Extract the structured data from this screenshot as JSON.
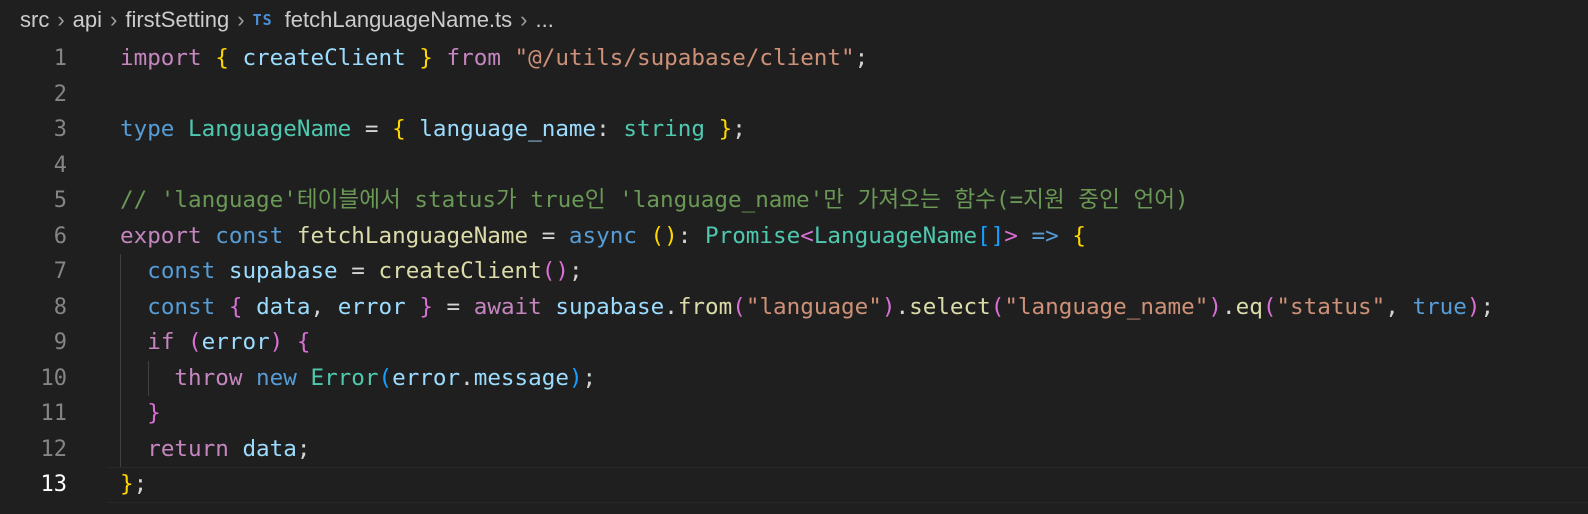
{
  "breadcrumb": {
    "items": [
      "src",
      "api",
      "firstSetting"
    ],
    "file_icon": "TS",
    "file_name": "fetchLanguageName.ts",
    "trailing": "..."
  },
  "editor": {
    "active_line": 13,
    "lines": [
      {
        "number": "1",
        "tokens": [
          {
            "t": "import",
            "c": "ctl"
          },
          {
            "t": " ",
            "c": "pn"
          },
          {
            "t": "{",
            "c": "b1"
          },
          {
            "t": " ",
            "c": "pn"
          },
          {
            "t": "createClient",
            "c": "var"
          },
          {
            "t": " ",
            "c": "pn"
          },
          {
            "t": "}",
            "c": "b1"
          },
          {
            "t": " ",
            "c": "pn"
          },
          {
            "t": "from",
            "c": "ctl"
          },
          {
            "t": " ",
            "c": "pn"
          },
          {
            "t": "\"@/utils/supabase/client\"",
            "c": "str"
          },
          {
            "t": ";",
            "c": "pn"
          }
        ]
      },
      {
        "number": "2",
        "tokens": []
      },
      {
        "number": "3",
        "tokens": [
          {
            "t": "type",
            "c": "kw"
          },
          {
            "t": " ",
            "c": "pn"
          },
          {
            "t": "LanguageName",
            "c": "typ"
          },
          {
            "t": " = ",
            "c": "pn"
          },
          {
            "t": "{",
            "c": "b1"
          },
          {
            "t": " ",
            "c": "pn"
          },
          {
            "t": "language_name",
            "c": "var"
          },
          {
            "t": ": ",
            "c": "pn"
          },
          {
            "t": "string",
            "c": "typ"
          },
          {
            "t": " ",
            "c": "pn"
          },
          {
            "t": "}",
            "c": "b1"
          },
          {
            "t": ";",
            "c": "pn"
          }
        ]
      },
      {
        "number": "4",
        "tokens": []
      },
      {
        "number": "5",
        "tokens": [
          {
            "t": "// 'language'테이블에서 status가 true인 'language_name'만 가져오는 함수(=지원 중인 언어)",
            "c": "com"
          }
        ]
      },
      {
        "number": "6",
        "tokens": [
          {
            "t": "export",
            "c": "ctl"
          },
          {
            "t": " ",
            "c": "pn"
          },
          {
            "t": "const",
            "c": "kw"
          },
          {
            "t": " ",
            "c": "pn"
          },
          {
            "t": "fetchLanguageName",
            "c": "fn"
          },
          {
            "t": " = ",
            "c": "pn"
          },
          {
            "t": "async",
            "c": "kw"
          },
          {
            "t": " ",
            "c": "pn"
          },
          {
            "t": "()",
            "c": "b1"
          },
          {
            "t": ": ",
            "c": "pn"
          },
          {
            "t": "Promise",
            "c": "typ"
          },
          {
            "t": "<",
            "c": "b2"
          },
          {
            "t": "LanguageName",
            "c": "typ"
          },
          {
            "t": "[]",
            "c": "b3"
          },
          {
            "t": ">",
            "c": "b2"
          },
          {
            "t": " ",
            "c": "pn"
          },
          {
            "t": "=>",
            "c": "kw"
          },
          {
            "t": " ",
            "c": "pn"
          },
          {
            "t": "{",
            "c": "b1"
          }
        ]
      },
      {
        "number": "7",
        "tokens": [
          {
            "t": "  ",
            "c": "pn"
          },
          {
            "t": "const",
            "c": "kw"
          },
          {
            "t": " ",
            "c": "pn"
          },
          {
            "t": "supabase",
            "c": "var"
          },
          {
            "t": " = ",
            "c": "pn"
          },
          {
            "t": "createClient",
            "c": "fn"
          },
          {
            "t": "()",
            "c": "b2"
          },
          {
            "t": ";",
            "c": "pn"
          }
        ]
      },
      {
        "number": "8",
        "tokens": [
          {
            "t": "  ",
            "c": "pn"
          },
          {
            "t": "const",
            "c": "kw"
          },
          {
            "t": " ",
            "c": "pn"
          },
          {
            "t": "{",
            "c": "b2"
          },
          {
            "t": " ",
            "c": "pn"
          },
          {
            "t": "data",
            "c": "var"
          },
          {
            "t": ", ",
            "c": "pn"
          },
          {
            "t": "error",
            "c": "var"
          },
          {
            "t": " ",
            "c": "pn"
          },
          {
            "t": "}",
            "c": "b2"
          },
          {
            "t": " = ",
            "c": "pn"
          },
          {
            "t": "await",
            "c": "ctl"
          },
          {
            "t": " ",
            "c": "pn"
          },
          {
            "t": "supabase",
            "c": "var"
          },
          {
            "t": ".",
            "c": "pn"
          },
          {
            "t": "from",
            "c": "fn"
          },
          {
            "t": "(",
            "c": "b2"
          },
          {
            "t": "\"language\"",
            "c": "str"
          },
          {
            "t": ")",
            "c": "b2"
          },
          {
            "t": ".",
            "c": "pn"
          },
          {
            "t": "select",
            "c": "fn"
          },
          {
            "t": "(",
            "c": "b2"
          },
          {
            "t": "\"language_name\"",
            "c": "str"
          },
          {
            "t": ")",
            "c": "b2"
          },
          {
            "t": ".",
            "c": "pn"
          },
          {
            "t": "eq",
            "c": "fn"
          },
          {
            "t": "(",
            "c": "b2"
          },
          {
            "t": "\"status\"",
            "c": "str"
          },
          {
            "t": ", ",
            "c": "pn"
          },
          {
            "t": "true",
            "c": "kw"
          },
          {
            "t": ")",
            "c": "b2"
          },
          {
            "t": ";",
            "c": "pn"
          }
        ]
      },
      {
        "number": "9",
        "tokens": [
          {
            "t": "  ",
            "c": "pn"
          },
          {
            "t": "if",
            "c": "ctl"
          },
          {
            "t": " ",
            "c": "pn"
          },
          {
            "t": "(",
            "c": "b2"
          },
          {
            "t": "error",
            "c": "var"
          },
          {
            "t": ")",
            "c": "b2"
          },
          {
            "t": " ",
            "c": "pn"
          },
          {
            "t": "{",
            "c": "b2"
          }
        ]
      },
      {
        "number": "10",
        "tokens": [
          {
            "t": "    ",
            "c": "pn"
          },
          {
            "t": "throw",
            "c": "ctl"
          },
          {
            "t": " ",
            "c": "pn"
          },
          {
            "t": "new",
            "c": "kw"
          },
          {
            "t": " ",
            "c": "pn"
          },
          {
            "t": "Error",
            "c": "typ"
          },
          {
            "t": "(",
            "c": "b3"
          },
          {
            "t": "error",
            "c": "var"
          },
          {
            "t": ".",
            "c": "pn"
          },
          {
            "t": "message",
            "c": "var"
          },
          {
            "t": ")",
            "c": "b3"
          },
          {
            "t": ";",
            "c": "pn"
          }
        ]
      },
      {
        "number": "11",
        "tokens": [
          {
            "t": "  ",
            "c": "pn"
          },
          {
            "t": "}",
            "c": "b2"
          }
        ]
      },
      {
        "number": "12",
        "tokens": [
          {
            "t": "  ",
            "c": "pn"
          },
          {
            "t": "return",
            "c": "ctl"
          },
          {
            "t": " ",
            "c": "pn"
          },
          {
            "t": "data",
            "c": "var"
          },
          {
            "t": ";",
            "c": "pn"
          }
        ]
      },
      {
        "number": "13",
        "tokens": [
          {
            "t": "}",
            "c": "b1"
          },
          {
            "t": ";",
            "c": "pn"
          }
        ]
      }
    ]
  }
}
